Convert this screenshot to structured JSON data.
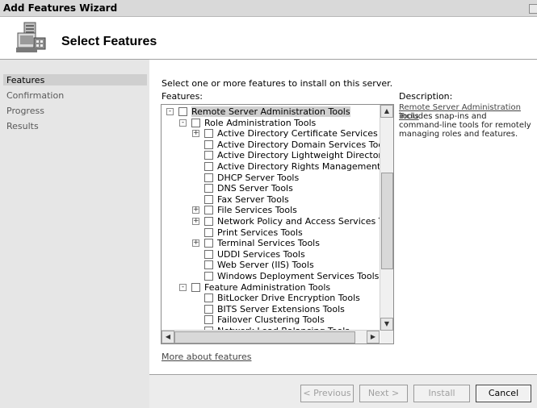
{
  "window": {
    "title": "Add Features Wizard"
  },
  "header": {
    "heading": "Select Features",
    "icon": "wizard-server-icon"
  },
  "nav": {
    "items": [
      "Features",
      "Confirmation",
      "Progress",
      "Results"
    ],
    "active": "Features"
  },
  "content": {
    "instructions": "Select one or more features to install on this server.",
    "features_label": "Features:",
    "description_label": "Description:",
    "description_link": "Remote Server Administration Tools",
    "description_text": "includes snap-ins and command-line tools for remotely managing roles and features.",
    "more_link": "More about features"
  },
  "tree": {
    "items": [
      {
        "label": "Remote Server Administration Tools",
        "level": 0,
        "expander": "-",
        "checked": false,
        "selected": true
      },
      {
        "label": "Role Administration Tools",
        "level": 1,
        "expander": "-",
        "checked": false
      },
      {
        "label": "Active Directory Certificate Services Tools",
        "level": 2,
        "expander": "+",
        "checked": false
      },
      {
        "label": "Active Directory Domain Services Tools",
        "level": 2,
        "expander": "",
        "checked": false
      },
      {
        "label": "Active Directory Lightweight Directory Services Tools",
        "level": 2,
        "expander": "",
        "checked": false
      },
      {
        "label": "Active Directory Rights Management Services Tools",
        "level": 2,
        "expander": "",
        "checked": false
      },
      {
        "label": "DHCP Server Tools",
        "level": 2,
        "expander": "",
        "checked": false
      },
      {
        "label": "DNS Server Tools",
        "level": 2,
        "expander": "",
        "checked": false
      },
      {
        "label": "Fax Server Tools",
        "level": 2,
        "expander": "",
        "checked": false
      },
      {
        "label": "File Services Tools",
        "level": 2,
        "expander": "+",
        "checked": false
      },
      {
        "label": "Network Policy and Access Services Tools",
        "level": 2,
        "expander": "+",
        "checked": false
      },
      {
        "label": "Print Services Tools",
        "level": 2,
        "expander": "",
        "checked": false
      },
      {
        "label": "Terminal Services Tools",
        "level": 2,
        "expander": "+",
        "checked": false
      },
      {
        "label": "UDDI Services Tools",
        "level": 2,
        "expander": "",
        "checked": false
      },
      {
        "label": "Web Server (IIS) Tools",
        "level": 2,
        "expander": "",
        "checked": false
      },
      {
        "label": "Windows Deployment Services Tools",
        "level": 2,
        "expander": "",
        "checked": false
      },
      {
        "label": "Feature Administration Tools",
        "level": 1,
        "expander": "-",
        "checked": false
      },
      {
        "label": "BitLocker Drive Encryption Tools",
        "level": 2,
        "expander": "",
        "checked": false
      },
      {
        "label": "BITS Server Extensions Tools",
        "level": 2,
        "expander": "",
        "checked": false
      },
      {
        "label": "Failover Clustering Tools",
        "level": 2,
        "expander": "",
        "checked": false
      },
      {
        "label": "Network Load Balancing Tools",
        "level": 2,
        "expander": "",
        "checked": false
      }
    ]
  },
  "buttons": {
    "previous": "< Previous",
    "next": "Next >",
    "install": "Install",
    "cancel": "Cancel"
  },
  "colors": {
    "nav_bg": "#e6e6e6",
    "title_bg": "#d9d9d9",
    "footer_bg": "#ececec"
  }
}
